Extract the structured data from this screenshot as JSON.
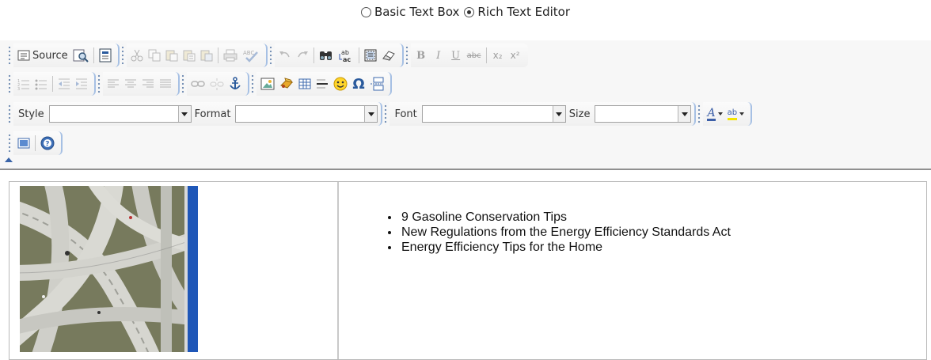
{
  "mode_switch": {
    "options": [
      {
        "label": "Basic Text Box",
        "checked": false
      },
      {
        "label": "Rich Text Editor",
        "checked": true
      }
    ]
  },
  "toolbar": {
    "source_label": "Source",
    "row1_icons": [
      "source-icon",
      "preview-icon",
      "templates-icon",
      "cut-icon",
      "copy-icon",
      "paste-icon",
      "paste-text-icon",
      "paste-word-icon",
      "print-icon",
      "spellcheck-icon",
      "undo-icon",
      "redo-icon",
      "find-icon",
      "replace-icon",
      "select-all-icon",
      "remove-format-icon",
      "bold-icon",
      "italic-icon",
      "underline-icon",
      "strike-icon",
      "subscript-icon",
      "superscript-icon"
    ],
    "bold_glyph": "B",
    "italic_glyph": "I",
    "underline_glyph": "U",
    "strike_glyph": "abc",
    "subscript_glyph": "x₂",
    "superscript_glyph": "x²",
    "style_label": "Style",
    "style_value": "",
    "format_label": "Format",
    "format_value": "",
    "font_label": "Font",
    "font_value": "",
    "size_label": "Size",
    "size_value": "",
    "text_color_glyph": "A",
    "bg_color_glyph": "ab",
    "omega_glyph": "Ω",
    "colors": {
      "accent": "#a6c0e4",
      "toolbar_bg": "#f7f7f7",
      "text_color_underline": "#3c5fa8",
      "bg_color_underline": "#f4e400"
    }
  },
  "content": {
    "image_alt": "highway interchange aerial photo",
    "list_items": [
      "9 Gasoline Conservation Tips",
      "New Regulations from the Energy Efficiency Standards Act",
      "Energy Efficiency Tips for the Home"
    ]
  }
}
